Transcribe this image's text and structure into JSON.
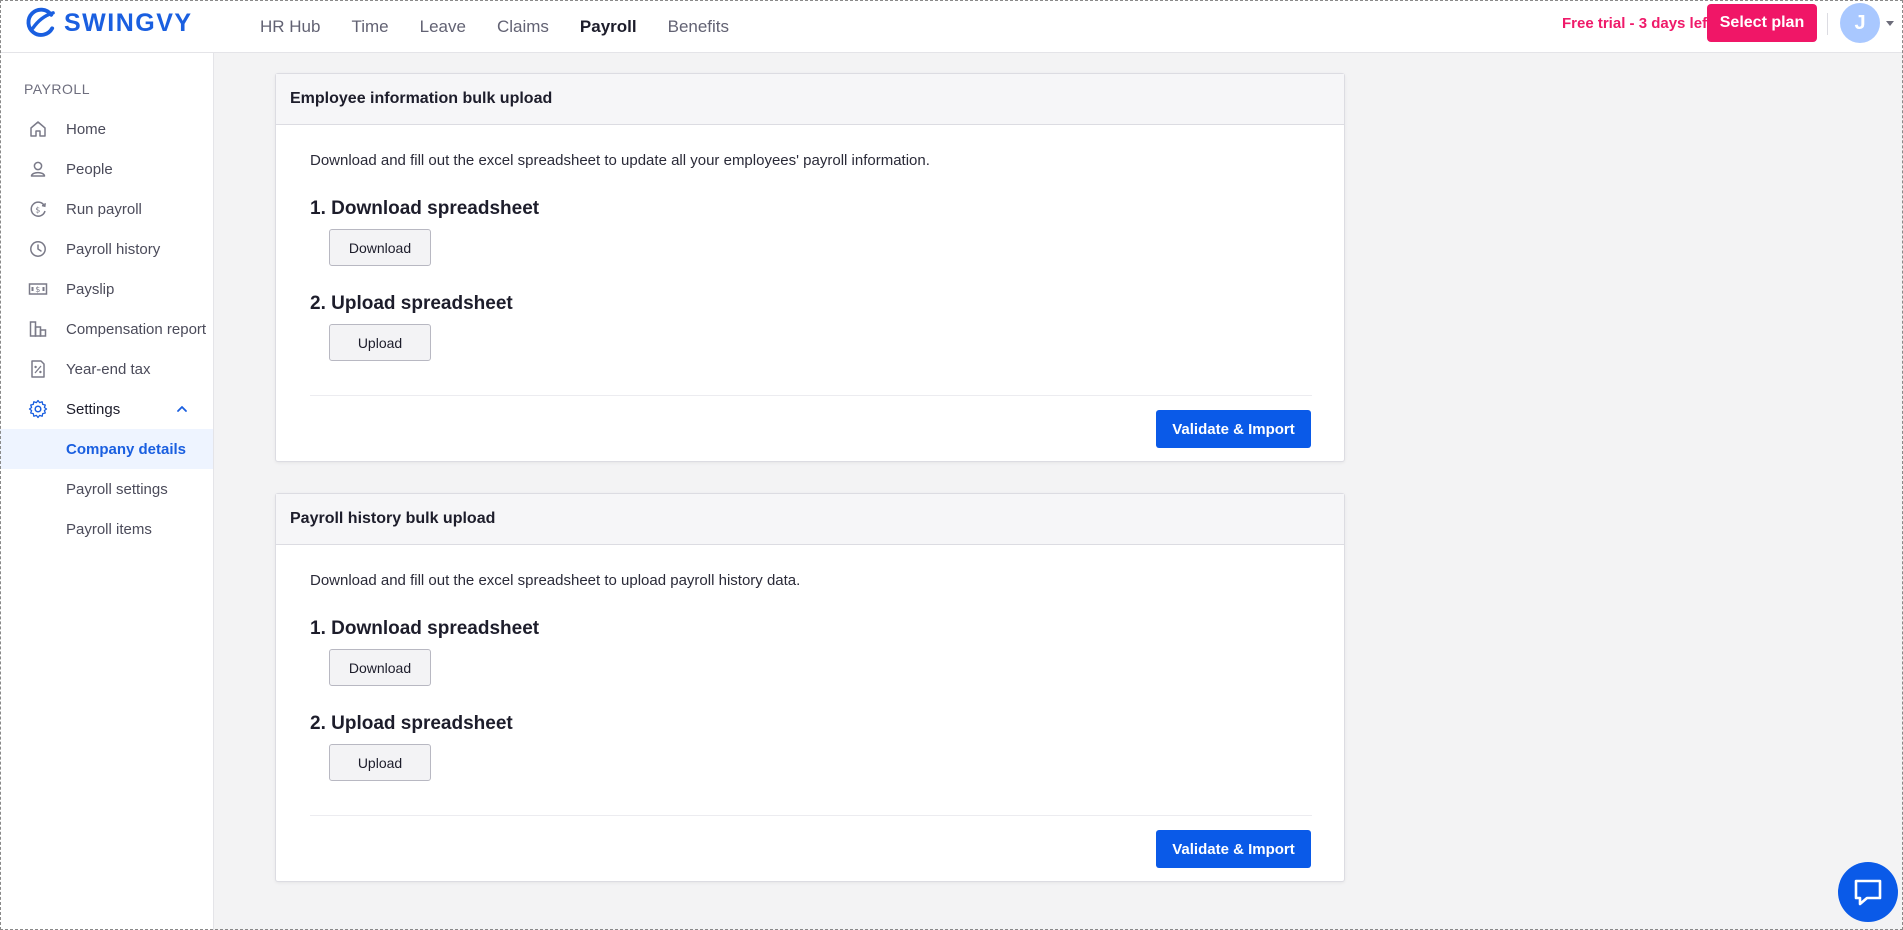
{
  "app": {
    "brand": "SWINGVY",
    "brand_color": "#1a5fe0",
    "accent_color": "#0a5ae8",
    "trial_color": "#f01667"
  },
  "topnav": {
    "items": [
      {
        "label": "HR Hub",
        "active": false
      },
      {
        "label": "Time",
        "active": false
      },
      {
        "label": "Leave",
        "active": false
      },
      {
        "label": "Claims",
        "active": false
      },
      {
        "label": "Payroll",
        "active": true
      },
      {
        "label": "Benefits",
        "active": false
      }
    ],
    "trial_text": "Free trial - 3 days left",
    "select_plan_label": "Select plan",
    "avatar_initial": "J"
  },
  "sidebar": {
    "heading": "PAYROLL",
    "items": [
      {
        "label": "Home",
        "icon": "home-icon"
      },
      {
        "label": "People",
        "icon": "person-icon"
      },
      {
        "label": "Run payroll",
        "icon": "run-payroll-icon"
      },
      {
        "label": "Payroll history",
        "icon": "history-clock-icon"
      },
      {
        "label": "Payslip",
        "icon": "payslip-icon"
      },
      {
        "label": "Compensation report",
        "icon": "bar-chart-icon"
      },
      {
        "label": "Year-end tax",
        "icon": "percent-doc-icon"
      },
      {
        "label": "Settings",
        "icon": "gear-icon",
        "expanded": true
      }
    ],
    "sub_items": [
      {
        "label": "Company details",
        "selected": true
      },
      {
        "label": "Payroll settings",
        "selected": false
      },
      {
        "label": "Payroll items",
        "selected": false
      }
    ]
  },
  "cards": [
    {
      "title": "Employee information bulk upload",
      "description": "Download and fill out the excel spreadsheet to update all your employees' payroll information.",
      "step1_title": "1. Download spreadsheet",
      "step1_button": "Download",
      "step2_title": "2. Upload spreadsheet",
      "step2_button": "Upload",
      "action_button": "Validate & Import"
    },
    {
      "title": "Payroll history bulk upload",
      "description": "Download and fill out the excel spreadsheet to upload payroll history data.",
      "step1_title": "1. Download spreadsheet",
      "step1_button": "Download",
      "step2_title": "2. Upload spreadsheet",
      "step2_button": "Upload",
      "action_button": "Validate & Import"
    }
  ]
}
